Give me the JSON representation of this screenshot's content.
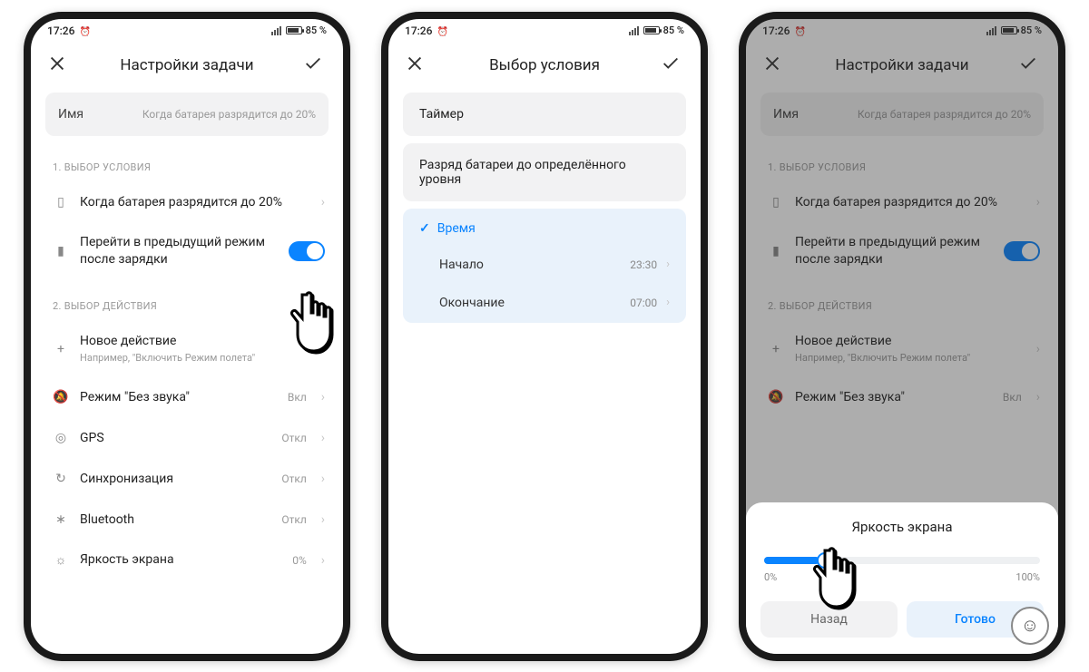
{
  "status": {
    "time": "17:26",
    "battery": "85 %"
  },
  "phone1": {
    "title": "Настройки задачи",
    "name_label": "Имя",
    "name_value": "Когда батарея разрядится до 20%",
    "section1": "1. ВЫБОР УСЛОВИЯ",
    "cond_text": "Когда батарея разрядится до 20%",
    "restore_text": "Перейти в предыдущий режим после зарядки",
    "section2": "2. ВЫБОР ДЕЙСТВИЯ",
    "new_action": "Новое действие",
    "new_action_hint": "Например, \"Включить Режим полета\"",
    "rows": [
      {
        "icon": "🔕",
        "label": "Режим \"Без звука\"",
        "value": "Вкл"
      },
      {
        "icon": "◎",
        "label": "GPS",
        "value": "Откл"
      },
      {
        "icon": "↻",
        "label": "Синхронизация",
        "value": "Откл"
      },
      {
        "icon": "∗",
        "label": "Bluetooth",
        "value": "Откл"
      },
      {
        "icon": "☼",
        "label": "Яркость экрана",
        "value": "0%"
      }
    ]
  },
  "phone2": {
    "title": "Выбор условия",
    "opt_timer": "Таймер",
    "opt_battery": "Разряд батареи до определённого уровня",
    "opt_time": "Время",
    "start_label": "Начало",
    "start_value": "23:30",
    "end_label": "Окончание",
    "end_value": "07:00"
  },
  "phone3": {
    "sheet_title": "Яркость экрана",
    "min": "0%",
    "max": "100%",
    "cancel": "Назад",
    "done": "Готово"
  }
}
